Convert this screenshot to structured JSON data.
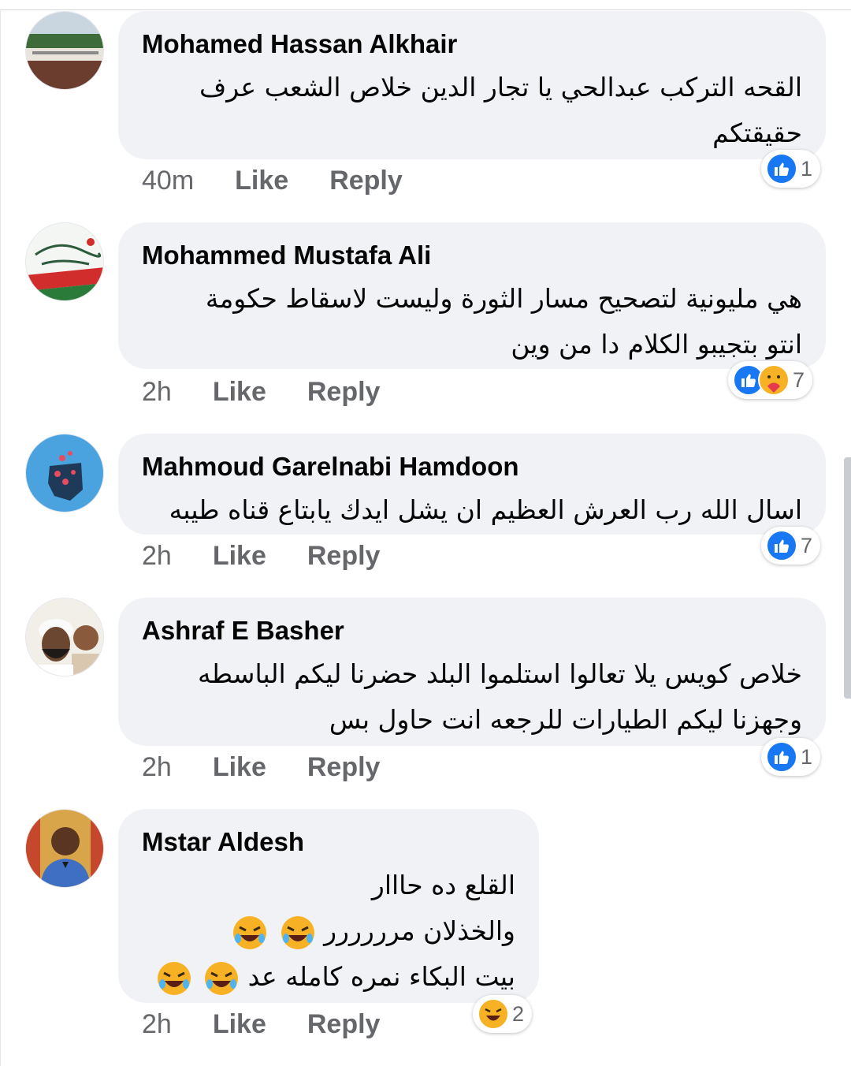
{
  "theme": {
    "bubble": "#f0f2f5",
    "meta_text": "#65676b",
    "like_blue": "#1877f2",
    "emoji_yellow": "#f7b125"
  },
  "actions": {
    "like_label": "Like",
    "reply_label": "Reply"
  },
  "comments": [
    {
      "author": "Mohamed Hassan Alkhair",
      "avatar_icon": "landscape-photo-icon",
      "lines": [
        "القحه التركب عبدالحي يا تجار الدين خلاص الشعب عرف",
        "حقيقتكم"
      ],
      "time": "40m",
      "reactions": [
        "like"
      ],
      "reaction_count": "1"
    },
    {
      "author": "Mohammed Mustafa Ali",
      "avatar_icon": "calligraphy-flag-icon",
      "lines": [
        "هي مليونية لتصحيح مسار الثورة وليست لاسقاط حكومة",
        "انتو بتجيبو الكلام دا من وين"
      ],
      "time": "2h",
      "reactions": [
        "like",
        "care"
      ],
      "reaction_count": "7"
    },
    {
      "author": "Mahmoud Garelnabi Hamdoon",
      "avatar_icon": "sudan-map-icon",
      "lines": [
        "اسال الله رب العرش العظيم ان يشل ايدك يابتاع قناه طيبه"
      ],
      "time": "2h",
      "reactions": [
        "like"
      ],
      "reaction_count": "7"
    },
    {
      "author": "Ashraf E Basher",
      "avatar_icon": "person-with-child-photo-icon",
      "lines": [
        "خلاص كويس يلا تعالوا استلموا البلد حضرنا ليكم الباسطه",
        "وجهزنا ليكم الطيارات للرجعه انت حاول بس"
      ],
      "time": "2h",
      "reactions": [
        "like"
      ],
      "reaction_count": "1"
    },
    {
      "author": "Mstar Aldesh",
      "avatar_icon": "person-photo-icon",
      "lines": [
        "القلع ده حااار",
        "والخذلان مرررررر",
        "بيت البكاء نمره كامله عد"
      ],
      "line_emojis": [
        "",
        "rolling-laughing-emoji x2",
        "rolling-laughing-emoji x2"
      ],
      "time": "2h",
      "reactions": [
        "haha"
      ],
      "reaction_count": "2"
    }
  ]
}
